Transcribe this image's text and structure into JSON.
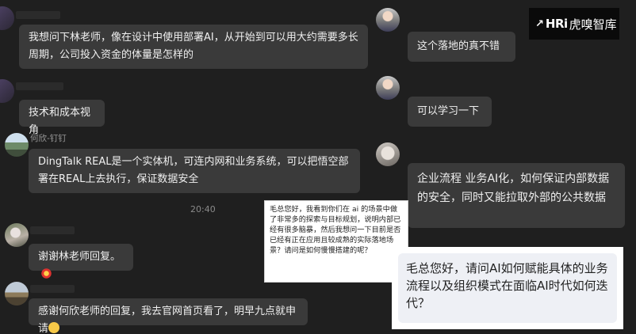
{
  "left_chat": {
    "messages": [
      {
        "text": "我想问下林老师，像在设计中使用部署AI，从开始到可以用大约需要多长周期，公司投入资金的体量是怎样的"
      },
      {
        "text": "技术和成本视角"
      },
      {
        "sender": "何欣-钉钉",
        "text": "DingTalk REAL是一个实体机，可连内网和业务系统，可以把悟空部署在REAL上去执行，保证数据安全"
      },
      {
        "text": "谢谢林老师回复。"
      },
      {
        "text": "感谢何欣老师的回复，我去官网首页看了，明早九点就申请"
      }
    ],
    "timestamp": "20:40"
  },
  "right_chat": {
    "messages": [
      {
        "text": "这个落地的真不错"
      },
      {
        "text": "可以学习一下"
      },
      {
        "text": "企业流程 业务AI化，如何保证内部数据的安全，同时又能拉取外部的公共数据"
      }
    ]
  },
  "overlay_small": {
    "text": "毛总您好，我看到你们在 ai 的场景中做了非常多的探索与目标规划，说明内部已经有很多脑暴，然后我想问一下目前是否已经有正在应用且较成熟的实际落地场景？请问是如何慢慢搭建的呢？"
  },
  "overlay_big": {
    "text": "毛总您好，请问AI如何赋能具体的业务流程以及组织模式在面临AI时代如何迭代？"
  },
  "logo": {
    "mark": "HRi",
    "brand": "虎嗅智库"
  }
}
